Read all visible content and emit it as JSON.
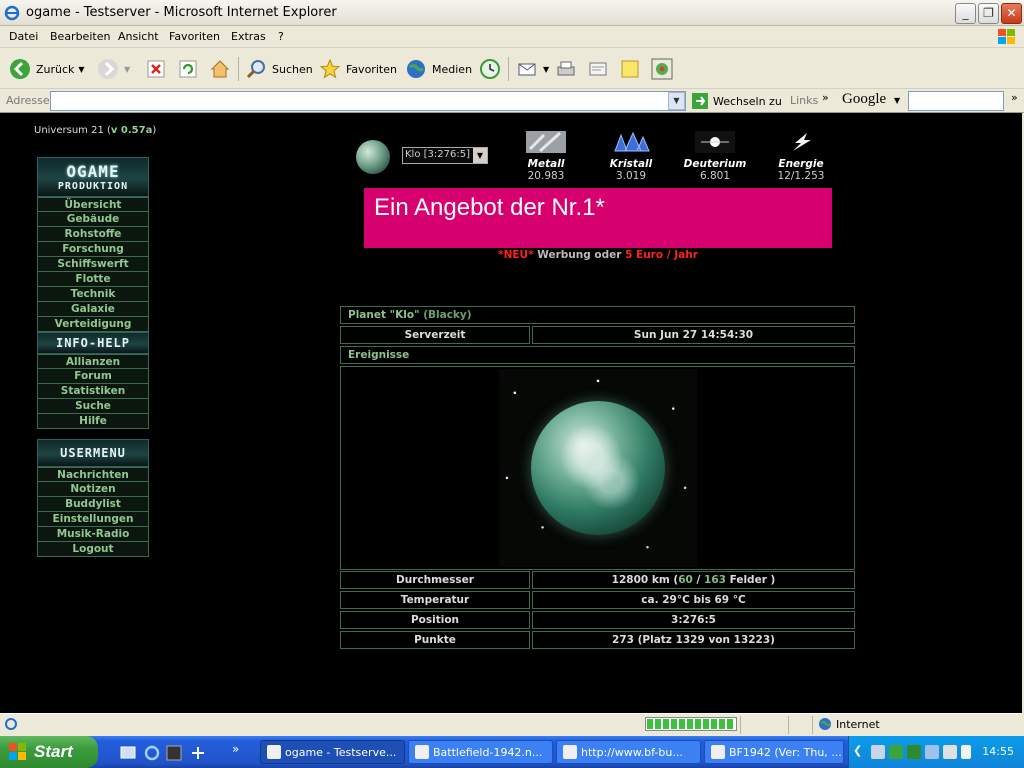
{
  "window": {
    "title": "ogame - Testserver - Microsoft Internet Explorer"
  },
  "menu": [
    "Datei",
    "Bearbeiten",
    "Ansicht",
    "Favoriten",
    "Extras",
    "?"
  ],
  "toolbar": {
    "back_label": "Zurück",
    "search_label": "Suchen",
    "favorites_label": "Favoriten",
    "media_label": "Medien"
  },
  "address": {
    "label": "Adresse",
    "value": "",
    "go_label": "Wechseln zu",
    "links_label": "Links",
    "google_label": "Google"
  },
  "page": {
    "universe_prefix": "Universum 21 (",
    "universe_version": "v 0.57a",
    "universe_suffix": ")",
    "menu_header_1_big": "OGAME",
    "menu_header_1_small": "PRODUKTION",
    "nav_main": [
      "Übersicht",
      "Gebäude",
      "Rohstoffe",
      "Forschung",
      "Schiffswerft",
      "Flotte",
      "Technik",
      "Galaxie",
      "Verteidigung"
    ],
    "menu_header_2": "INFO-HELP",
    "nav_info": [
      "Allianzen",
      "Forum",
      "Statistiken",
      "Suche",
      "Hilfe"
    ],
    "menu_header_3": "USERMENU",
    "nav_user": [
      "Nachrichten",
      "Notizen",
      "Buddylist",
      "Einstellungen",
      "Musik-Radio",
      "Logout"
    ],
    "planet_select": "Klo [3:276:5]",
    "resources": [
      {
        "name": "Metall",
        "value": "20.983"
      },
      {
        "name": "Kristall",
        "value": "3.019"
      },
      {
        "name": "Deuterium",
        "value": "6.801"
      },
      {
        "name": "Energie",
        "value": "12/1.253"
      }
    ],
    "banner_text": "Ein Angebot der Nr.1*",
    "ad_new": "*NEU*",
    "ad_mid": " Werbung oder ",
    "ad_price": "5 Euro / Jahr",
    "planet_title": "Planet \"Klo\"",
    "planet_owner": "(Blacky)",
    "servertime_label": "Serverzeit",
    "servertime_value": "Sun Jun 27 14:54:30",
    "events_label": "Ereignisse",
    "diameter_label": "Durchmesser",
    "diameter_km": "12800 km (",
    "fields_used": "60",
    "fields_sep": " / ",
    "fields_total": "163",
    "fields_suffix": " Felder )",
    "temperature_label": "Temperatur",
    "temperature_value": "ca. 29°C bis 69 °C",
    "position_label": "Position",
    "position_value": "3:276:5",
    "points_label": "Punkte",
    "points_value": "273 (Platz 1329 von 13223)"
  },
  "status": {
    "zone": "Internet",
    "progress": 1.0
  },
  "taskbar": {
    "start": "Start",
    "tasks": [
      "ogame - Testserve...",
      "Battlefield-1942.n...",
      "http://www.bf-bu...",
      "BF1942 (Ver: Thu, ..."
    ],
    "clock": "14:55"
  }
}
